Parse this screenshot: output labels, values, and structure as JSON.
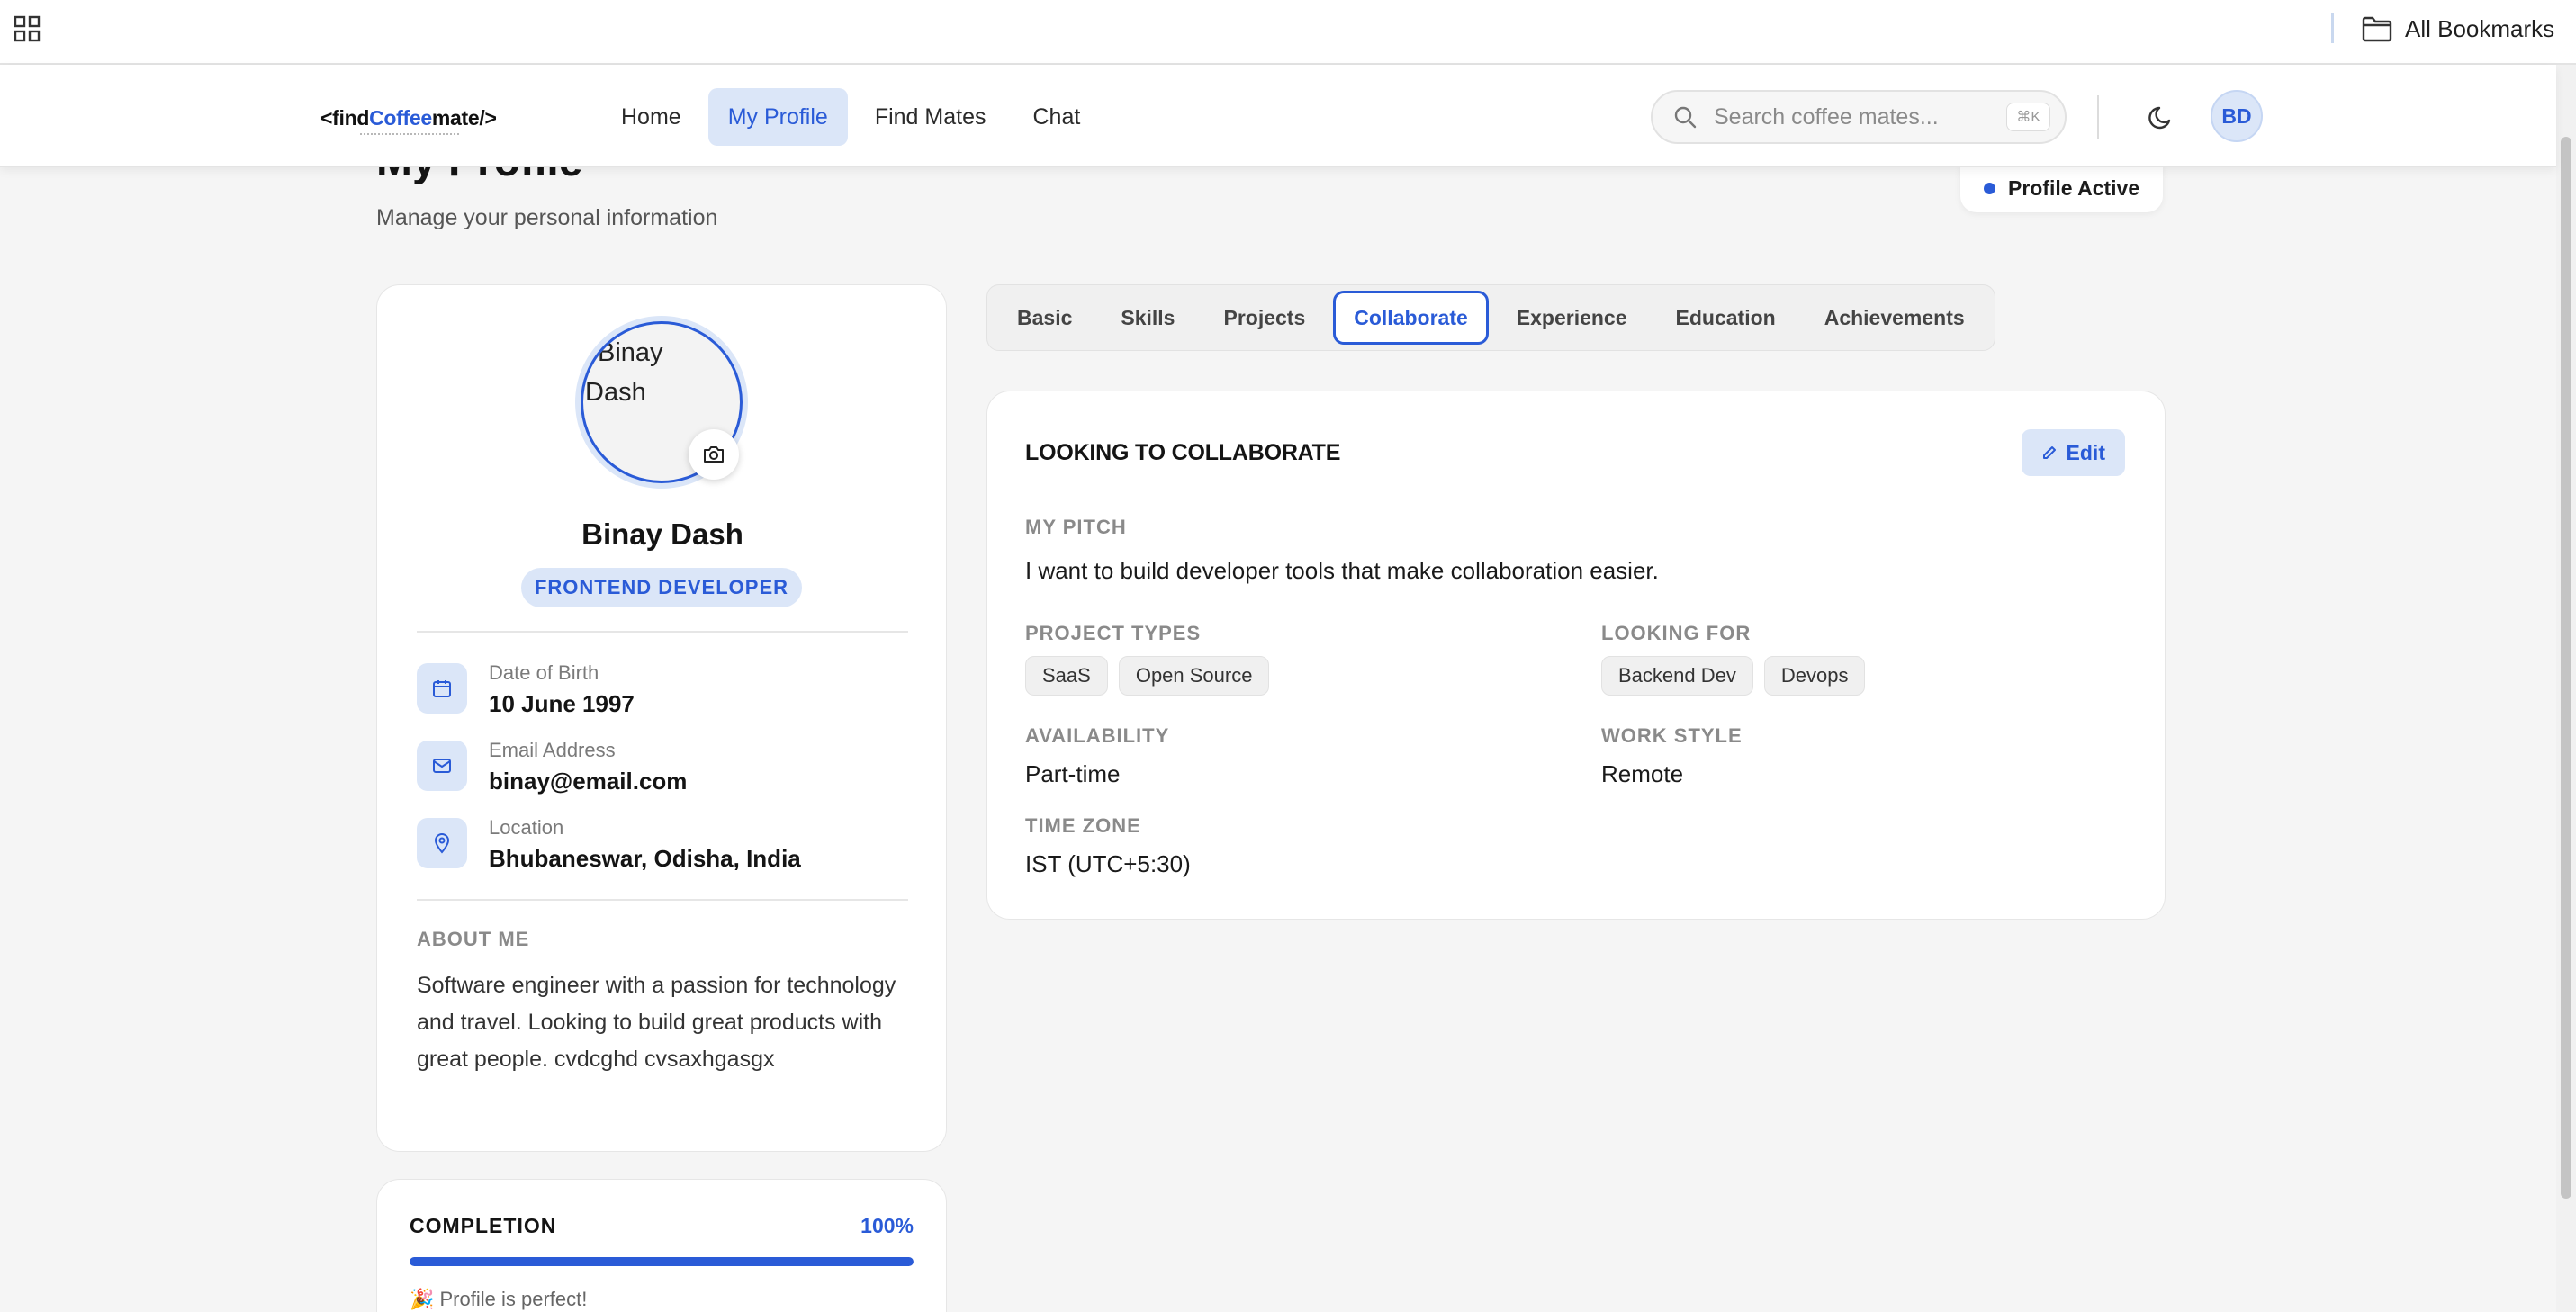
{
  "bookmarks_bar": {
    "all_bookmarks_label": "All Bookmarks"
  },
  "header": {
    "logo_prefix": "<find",
    "logo_accent": "Coffee",
    "logo_suffix": "mate/>",
    "nav": [
      {
        "label": "Home",
        "active": false
      },
      {
        "label": "My Profile",
        "active": true
      },
      {
        "label": "Find Mates",
        "active": false
      },
      {
        "label": "Chat",
        "active": false
      }
    ],
    "search_placeholder": "Search coffee mates...",
    "search_shortcut": "⌘K",
    "avatar_initials": "BD"
  },
  "page": {
    "title": "My Profile",
    "subtitle": "Manage your personal information",
    "status": "Profile Active"
  },
  "profile": {
    "photo_alt": "Binay Dash",
    "name": "Binay Dash",
    "role": "FRONTEND DEVELOPER",
    "dob_label": "Date of Birth",
    "dob_value": "10 June 1997",
    "email_label": "Email Address",
    "email_value": "binay@email.com",
    "location_label": "Location",
    "location_value": "Bhubaneswar, Odisha, India",
    "about_label": "ABOUT ME",
    "about_text": "Software engineer with a passion for technology and travel. Looking to build great products with great people. cvdcghd cvsaxhgasgx"
  },
  "completion": {
    "label": "COMPLETION",
    "percent_text": "100%",
    "percent_value": 100,
    "message": "🎉 Profile is perfect!"
  },
  "tabs": [
    {
      "label": "Basic",
      "active": false
    },
    {
      "label": "Skills",
      "active": false
    },
    {
      "label": "Projects",
      "active": false
    },
    {
      "label": "Collaborate",
      "active": true
    },
    {
      "label": "Experience",
      "active": false
    },
    {
      "label": "Education",
      "active": false
    },
    {
      "label": "Achievements",
      "active": false
    }
  ],
  "collaborate": {
    "title": "LOOKING TO COLLABORATE",
    "edit_label": "Edit",
    "pitch_label": "MY PITCH",
    "pitch_text": "I want to build developer tools that make collaboration easier.",
    "project_types_label": "PROJECT TYPES",
    "project_types": [
      "SaaS",
      "Open Source"
    ],
    "looking_for_label": "LOOKING FOR",
    "looking_for": [
      "Backend Dev",
      "Devops"
    ],
    "availability_label": "AVAILABILITY",
    "availability_value": "Part-time",
    "work_style_label": "WORK STYLE",
    "work_style_value": "Remote",
    "time_zone_label": "TIME ZONE",
    "time_zone_value": "IST (UTC+5:30)"
  },
  "colors": {
    "accent": "#2a5bd7",
    "accent_soft": "#dbe6f8",
    "page_bg": "#f5f5f5"
  }
}
